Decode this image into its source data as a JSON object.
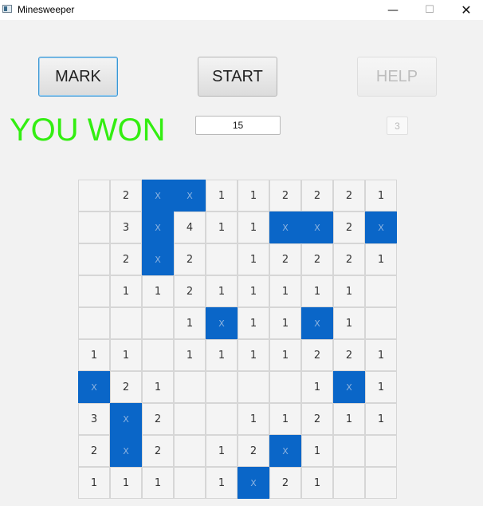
{
  "window": {
    "title": "Minesweeper",
    "minimize_icon": "minimize-icon",
    "maximize_icon": "maximize-icon",
    "close_icon": "close-icon",
    "minimize_glyph": "—",
    "maximize_glyph": "☐",
    "close_glyph": "✕"
  },
  "toolbar": {
    "mark_label": "MARK",
    "start_label": "START",
    "help_label": "HELP"
  },
  "status": {
    "message": "YOU WON",
    "message_color": "#33ee11"
  },
  "fields": {
    "count_value": "15",
    "help_value": "3"
  },
  "colors": {
    "mine_cell": "#0a66c8"
  },
  "board": {
    "rows": [
      [
        "",
        "2",
        "X",
        "X",
        "1",
        "1",
        "2",
        "2",
        "2",
        "1"
      ],
      [
        "",
        "3",
        "X",
        "4",
        "1",
        "1",
        "X",
        "X",
        "2",
        "X"
      ],
      [
        "",
        "2",
        "X",
        "2",
        "",
        "1",
        "2",
        "2",
        "2",
        "1"
      ],
      [
        "",
        "1",
        "1",
        "2",
        "1",
        "1",
        "1",
        "1",
        "1",
        ""
      ],
      [
        "",
        "",
        "",
        "1",
        "X",
        "1",
        "1",
        "X",
        "1",
        ""
      ],
      [
        "1",
        "1",
        "",
        "1",
        "1",
        "1",
        "1",
        "2",
        "2",
        "1"
      ],
      [
        "X",
        "2",
        "1",
        "",
        "",
        "",
        "",
        "1",
        "X",
        "1"
      ],
      [
        "3",
        "X",
        "2",
        "",
        "",
        "1",
        "1",
        "2",
        "1",
        "1"
      ],
      [
        "2",
        "X",
        "2",
        "",
        "1",
        "2",
        "X",
        "1",
        "",
        ""
      ],
      [
        "1",
        "1",
        "1",
        "",
        "1",
        "X",
        "2",
        "1",
        "",
        ""
      ]
    ]
  }
}
